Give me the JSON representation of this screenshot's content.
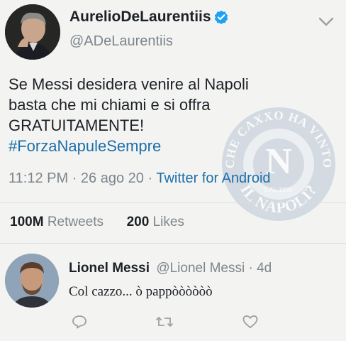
{
  "tweet": {
    "author_name": "AurelioDeLaurentiis",
    "author_handle": "@ADeLaurentiis",
    "text_line1": "Se Messi desidera venire al Napoli",
    "text_line2": "basta che mi chiami e si offra",
    "text_line3": "GRATUITAMENTE!",
    "hashtag": "#ForzaNapuleSempre",
    "time": "11:12 PM",
    "sep1": "·",
    "date": "26 ago 20",
    "sep2": "·",
    "source": "Twitter for Android",
    "retweets_count": "100M",
    "retweets_label": "Retweets",
    "likes_count": "200",
    "likes_label": "Likes"
  },
  "watermark": {
    "top_text": "CHE CAXXO HA VINTO",
    "bottom_text": "IL NAPOLI?",
    "year": "DAL 1926"
  },
  "reply": {
    "author_name": "Lionel Messi",
    "author_handle": "@Lionel Messi",
    "sep": "·",
    "age": "4d",
    "text": "Col cazzo... ò pappòòòòòò"
  },
  "icons": {
    "verified": "verified-badge-icon",
    "menu": "chevron-down-icon",
    "reply": "reply-icon",
    "retweet": "retweet-icon",
    "like": "heart-icon"
  },
  "colors": {
    "link": "#1d6fa8",
    "verified": "#1da1f2",
    "background": "#f3f4f2",
    "divider": "#dcdedd"
  }
}
